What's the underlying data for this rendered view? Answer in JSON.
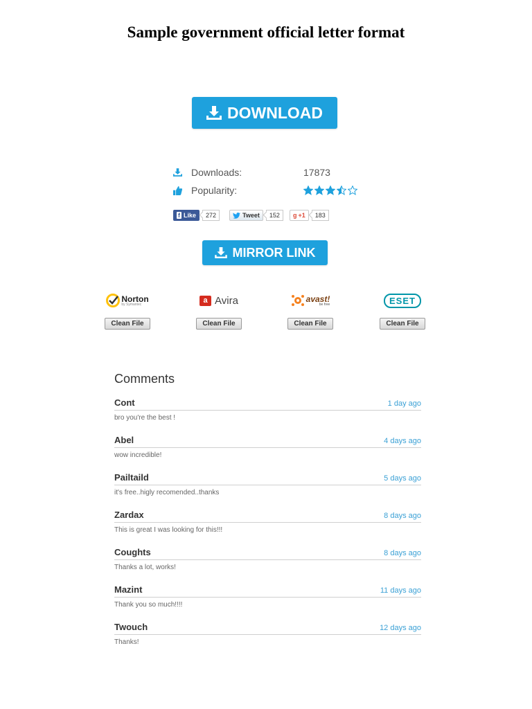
{
  "document": {
    "title": "Sample government official letter format"
  },
  "download_button": {
    "label": "DOWNLOAD",
    "icon": "download-icon"
  },
  "stats": {
    "downloads_label": "Downloads:",
    "downloads_value": "17873",
    "popularity_label": "Popularity:",
    "popularity_rating": 3.5,
    "popularity_max": 5
  },
  "social": {
    "facebook": {
      "label": "Like",
      "count": "272"
    },
    "twitter": {
      "label": "Tweet",
      "count": "152"
    },
    "google": {
      "label": "+1",
      "count": "183"
    }
  },
  "mirror_button": {
    "label": "MIRROR LINK",
    "icon": "download-icon"
  },
  "antivirus": [
    {
      "name": "Norton",
      "sub": "by Symantec",
      "button": "Clean File"
    },
    {
      "name": "Avira",
      "button": "Clean File"
    },
    {
      "name": "avast!",
      "sub": "be free",
      "button": "Clean File"
    },
    {
      "name": "eset",
      "button": "Clean File"
    }
  ],
  "comments_heading": "Comments",
  "comments": [
    {
      "name": "Cont",
      "time": "1 day ago",
      "text": "bro you're the best !"
    },
    {
      "name": "Abel",
      "time": "4 days ago",
      "text": "wow incredible!"
    },
    {
      "name": "Pailtaild",
      "time": "5 days ago",
      "text": "it's free..higly recomended..thanks"
    },
    {
      "name": "Zardax",
      "time": "8 days ago",
      "text": "This is great I was looking for this!!!"
    },
    {
      "name": "Coughts",
      "time": "8 days ago",
      "text": "Thanks a lot, works!"
    },
    {
      "name": "Mazint",
      "time": "11 days ago",
      "text": "Thank you so much!!!!"
    },
    {
      "name": "Twouch",
      "time": "12 days ago",
      "text": "Thanks!"
    }
  ],
  "colors": {
    "accent": "#1ea1dd",
    "time_link": "#3aa0d5",
    "facebook": "#3b5998",
    "google": "#dd4b39",
    "avira": "#d52b1e",
    "avast": "#f58220",
    "eset": "#0096a9",
    "norton": "#ffc20e"
  }
}
